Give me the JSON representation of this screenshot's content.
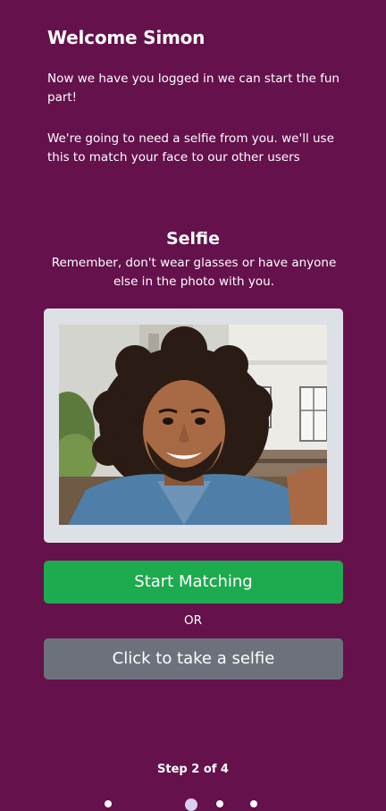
{
  "header": {
    "title": "Welcome Simon"
  },
  "intro": {
    "line1": "Now we have you logged in we can start the fun part!",
    "line2": "We're going to need a selfie from you. we'll use this to match your face to our other users"
  },
  "selfie_section": {
    "title": "Selfie",
    "description": "Remember, don't wear glasses or have anyone else in the photo with you."
  },
  "actions": {
    "start_label": "Start Matching",
    "or_label": "OR",
    "selfie_label": "Click to take a selfie"
  },
  "progress": {
    "step_label": "Step 2 of 4",
    "current_step": 2,
    "total_steps": 4
  },
  "colors": {
    "background": "#64114c",
    "primary_button": "#1eaa4e",
    "secondary_button": "#6c717b"
  }
}
